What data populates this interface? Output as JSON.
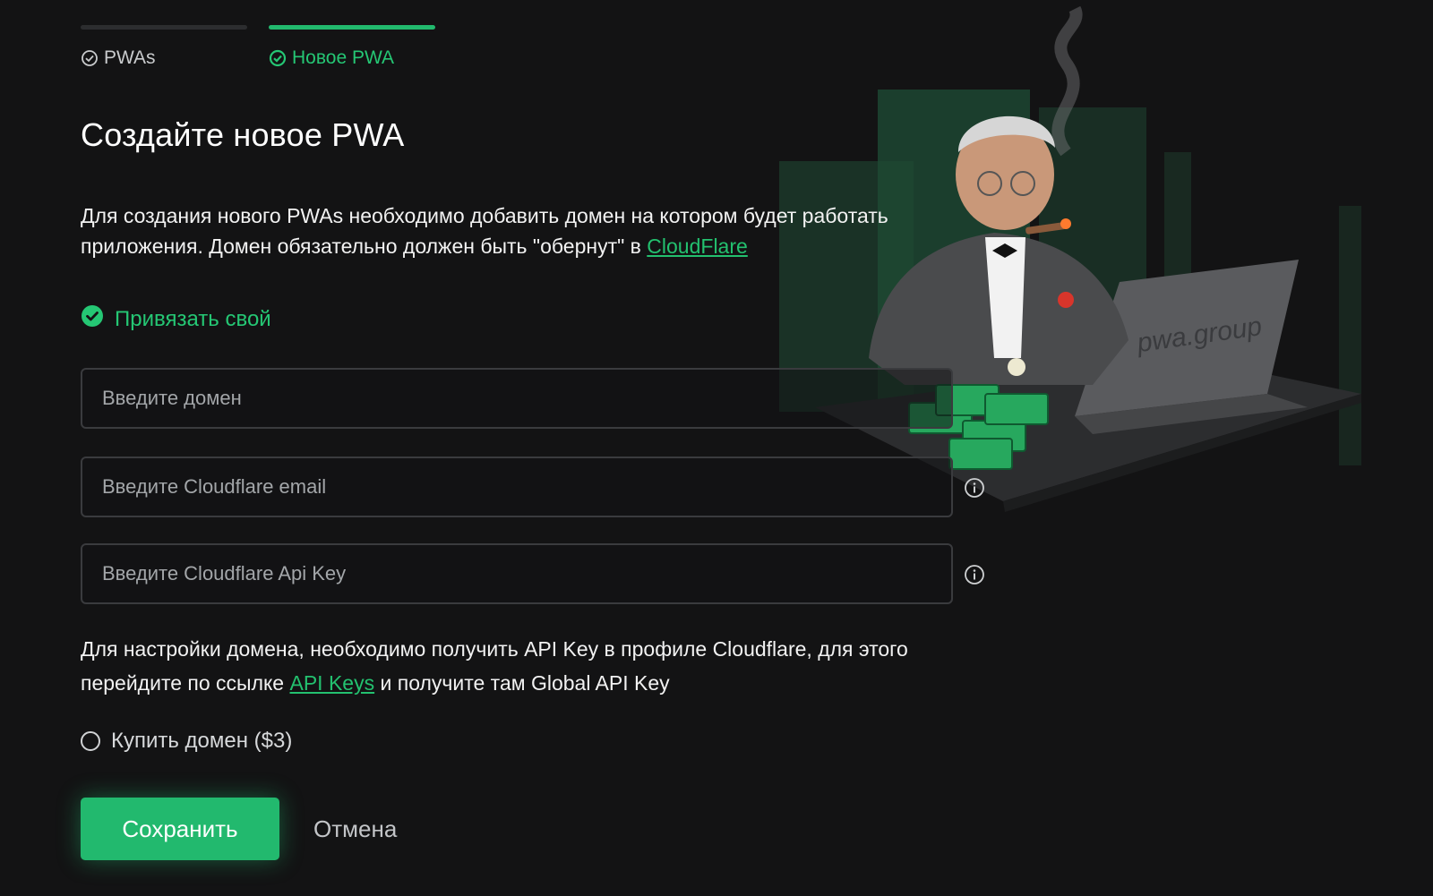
{
  "stepper": {
    "steps": [
      {
        "label": "PWAs",
        "active": false
      },
      {
        "label": "Новое PWA",
        "active": true
      }
    ]
  },
  "page": {
    "title": "Создайте новое PWA",
    "intro_text": "Для создания нового PWAs необходимо добавить домен на котором будет работать приложения. Домен обязательно должен быть \"обернут\" в ",
    "intro_link": "CloudFlare"
  },
  "options": {
    "bind_own": {
      "label": "Привязать свой",
      "selected": true
    },
    "buy_domain": {
      "label": "Купить домен ($3)",
      "selected": false
    }
  },
  "form": {
    "domain": {
      "placeholder": "Введите домен",
      "value": ""
    },
    "cloudflare_email": {
      "placeholder": "Введите Cloudflare email",
      "value": ""
    },
    "cloudflare_api_key": {
      "placeholder": "Введите Cloudflare Api Key",
      "value": ""
    }
  },
  "help": {
    "text_before": "Для настройки домена, необходимо получить API Key в профиле Cloudflare, для этого перейдите по ссылке ",
    "link": "API Keys",
    "text_after": " и получите там Global API Key"
  },
  "actions": {
    "save_label": "Сохранить",
    "cancel_label": "Отмена"
  },
  "illustration": {
    "laptop_text": "pwa.group"
  },
  "colors": {
    "background": "#131314",
    "accent": "#22b96e",
    "input_border": "#3a3b3e",
    "text_muted": "#a3a6a9"
  },
  "icons": {
    "step": "check-circle-icon",
    "bind_option": "check-circle-filled-icon",
    "info": "info-icon"
  }
}
